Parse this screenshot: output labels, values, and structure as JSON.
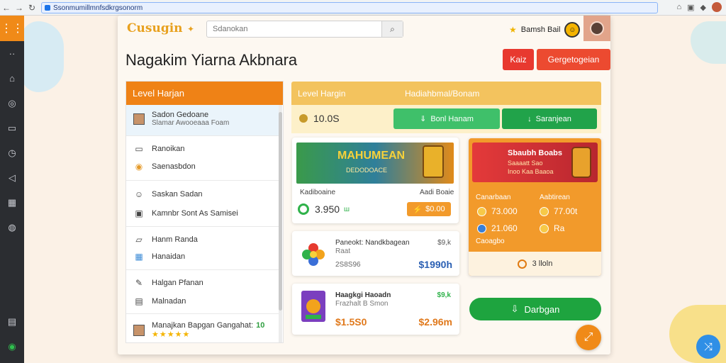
{
  "browser": {
    "url": "Ssonmumillmnfsdkrgsonorm",
    "nav_back_icon": "arrow-left-icon",
    "nav_forward_icon": "arrow-right-icon",
    "reload_icon": "reload-icon"
  },
  "rail": {
    "items": [
      "grid-icon",
      "dots-icon",
      "home-icon",
      "compass-icon",
      "square-icon",
      "clock-icon",
      "send-icon",
      "table-icon",
      "lock-icon"
    ],
    "bottom": [
      "layers-icon",
      "green-circle-icon"
    ]
  },
  "header": {
    "logo": "Cusugin",
    "search_placeholder": "Sdanokan",
    "user_label": "Bamsh Bail",
    "user_badge": "☺"
  },
  "page": {
    "title": "Nagakim Yiarna Akbnara",
    "btn_small": "Kaiz",
    "btn_large": "Gergetogeian"
  },
  "level_panel": {
    "title": "Level Harjan",
    "items": [
      {
        "title": "Sadon Gedoane",
        "sub": "Slamar Awooeaaa Foam"
      },
      {
        "title": "Ranoikan",
        "sub": "Saenasbdon"
      },
      {
        "title": "Saskan Sadan",
        "sub": "Kamnbr Sont As Samisei"
      },
      {
        "title": "Hanm Randa",
        "sub": "Hanaidan"
      },
      {
        "title": "Halgan Pfanan",
        "sub": "Malnadan"
      },
      {
        "title": "Manajkan Bapgan Gangahat:",
        "num": "10",
        "stars": "★★★★★"
      }
    ]
  },
  "content": {
    "head_left": "Level Hargin",
    "head_right": "Hadiahbmal/Bonam",
    "balance": "10.0S",
    "btn_green1": "Bonl Hanam",
    "btn_green2": "Saranjean"
  },
  "card_main": {
    "banner_title": "MAHUMEAN",
    "banner_sub": "DEDODOACE",
    "label_left": "Kadiboaine",
    "label_right": "Aadi Boaie",
    "price": "3.950",
    "price_unit": "ш",
    "chip": "$0.00"
  },
  "products": [
    {
      "name": "Paneokt: Nandkbagean",
      "sub": "Raat",
      "count": "2S8S96",
      "delta": "$9,k",
      "price": "$1990h"
    },
    {
      "name": "Haagkgi Haoadn",
      "sub": "Frazhalt B Smon",
      "count": "$1.5S0",
      "delta": "$9,k",
      "price": "$2.96m"
    }
  ],
  "offer": {
    "title": "Sbaubh Boabs",
    "line1": "Saaaatt Sao",
    "line2": "Inoo Kaa Baaoa",
    "label_left": "Canarbaan",
    "label_right": "Aabtirean",
    "val1": "73.000",
    "val2": "77.00t",
    "val3": "21.060",
    "val4": "Ra",
    "label_bottom": "Caoagbo",
    "footer": "3 lloln"
  },
  "actions": {
    "bargain": "Darbgan",
    "fab_icon": "expand-icon",
    "fab_blue_icon": "shuffle-icon"
  },
  "colors": {
    "accent_orange": "#ef8216",
    "green": "#1ea43f",
    "red": "#e8392f",
    "yellow_head": "#f3c35e"
  }
}
